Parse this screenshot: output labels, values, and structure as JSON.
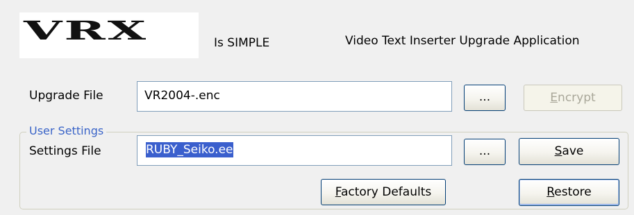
{
  "header": {
    "logo_text": "VRX",
    "tagline": "Is SIMPLE",
    "app_title": "Video Text Inserter Upgrade Application"
  },
  "upgrade": {
    "label": "Upgrade File",
    "value": "VR2004-.enc",
    "browse_label": "...",
    "encrypt_label": "Encrypt",
    "encrypt_mnemonic": "E",
    "encrypt_rest": "ncrypt"
  },
  "user_settings": {
    "legend": "User Settings",
    "settings_label": "Settings File",
    "settings_value": "RUBY_Seiko.ee",
    "browse_label": "...",
    "save_label": "Save",
    "save_mnemonic": "S",
    "save_rest": "ave",
    "factory_label": "Factory Defaults",
    "factory_mnemonic": "F",
    "factory_rest": "actory Defaults",
    "restore_label": "Restore",
    "restore_mnemonic": "R",
    "restore_rest": "estore"
  }
}
